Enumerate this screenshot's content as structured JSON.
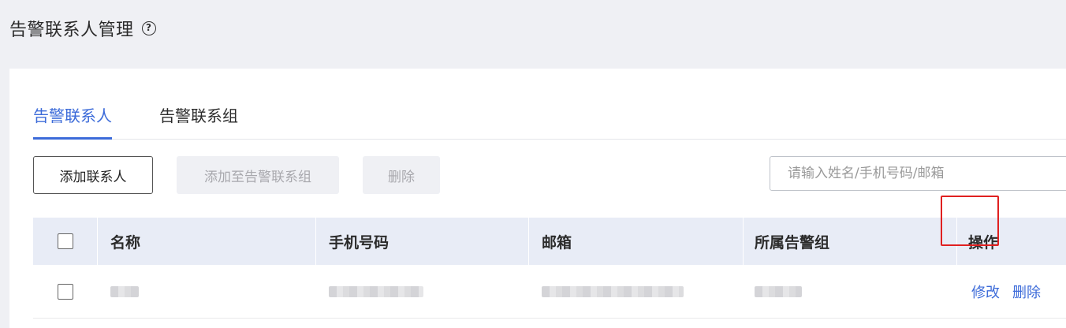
{
  "page": {
    "title": "告警联系人管理",
    "help": "?"
  },
  "tabs": [
    {
      "label": "告警联系人",
      "active": true
    },
    {
      "label": "告警联系组",
      "active": false
    }
  ],
  "toolbar": {
    "add_contact": "添加联系人",
    "add_to_group": "添加至告警联系组",
    "delete": "删除"
  },
  "search": {
    "placeholder": "请输入姓名/手机号码/邮箱"
  },
  "table": {
    "headers": {
      "name": "名称",
      "phone": "手机号码",
      "email": "邮箱",
      "group": "所属告警组",
      "ops": "操作"
    },
    "rows": [
      {
        "name": "",
        "phone": "",
        "email": "",
        "group": "",
        "edit": "修改",
        "delete": "删除"
      }
    ]
  },
  "colors": {
    "accent": "#3c6bd9",
    "highlight": "#e02020"
  }
}
